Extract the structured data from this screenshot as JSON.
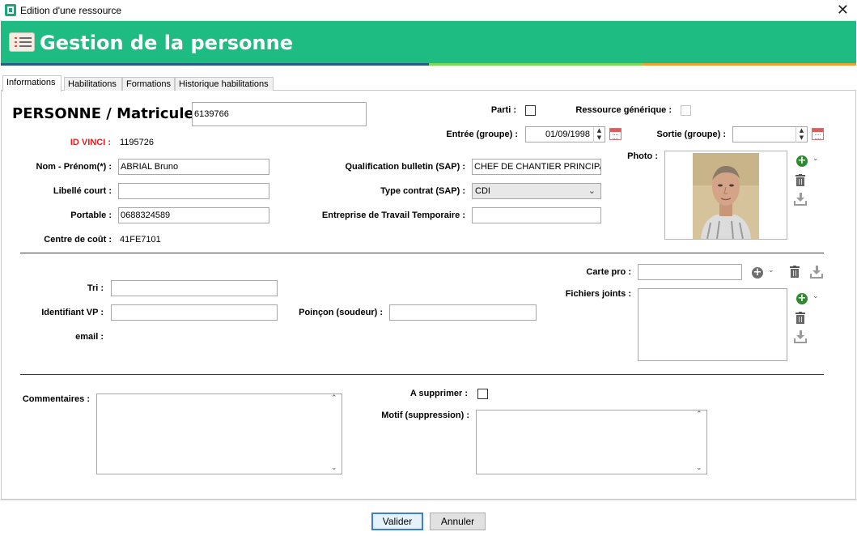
{
  "window": {
    "title": "Edition d'une ressource",
    "close_glyph": "✕"
  },
  "header": {
    "title": "Gestion de la personne",
    "colors": {
      "header_bg": "#1ebc82",
      "stripe_blue": "#2a5a8c",
      "stripe_green": "#7ed957",
      "stripe_orange": "#f0a030"
    }
  },
  "tabs": [
    {
      "label": "Informations",
      "active": true
    },
    {
      "label": "Habilitations",
      "active": false
    },
    {
      "label": "Formations",
      "active": false
    },
    {
      "label": "Historique habilitations",
      "active": false
    }
  ],
  "main": {
    "title": "PERSONNE / Matricule",
    "matricule": "6139766",
    "id_vinci_label": "ID VINCI :",
    "id_vinci_value": "1195726",
    "nom_prenom_label": "Nom - Prénom(*) :",
    "nom_prenom_value": "ABRIAL Bruno",
    "libelle_court_label": "Libellé court :",
    "libelle_court_value": "",
    "portable_label": "Portable :",
    "portable_value": "0688324589",
    "centre_cout_label": "Centre de coût :",
    "centre_cout_value": "41FE7101",
    "parti_label": "Parti :",
    "ressource_generique_label": "Ressource générique :",
    "entree_label": "Entrée (groupe) :",
    "entree_value": "01/09/1998",
    "sortie_label": "Sortie (groupe) :",
    "sortie_value": "",
    "qualification_label": "Qualification bulletin (SAP) :",
    "qualification_value": "CHEF DE CHANTIER PRINCIPAL",
    "type_contrat_label": "Type contrat (SAP) :",
    "type_contrat_value": "CDI",
    "ett_label": "Entreprise de Travail Temporaire :",
    "ett_value": "",
    "photo_label": "Photo :"
  },
  "section2": {
    "tri_label": "Tri :",
    "tri_value": "",
    "identifiant_vp_label": "Identifiant VP :",
    "identifiant_vp_value": "",
    "email_label": "email :",
    "poincon_label": "Poinçon (soudeur) :",
    "poincon_value": "",
    "carte_pro_label": "Carte pro :",
    "carte_pro_value": "",
    "fichiers_joints_label": "Fichiers joints :"
  },
  "section3": {
    "commentaires_label": "Commentaires :",
    "a_supprimer_label": "A supprimer :",
    "motif_label": "Motif (suppression) :"
  },
  "icons": {
    "add": "+",
    "chevron": "⌄",
    "up": "▲",
    "down": "▼",
    "scroll_up": "⌃",
    "scroll_down": "⌄"
  },
  "footer": {
    "validate_label": "Valider",
    "cancel_label": "Annuler"
  }
}
